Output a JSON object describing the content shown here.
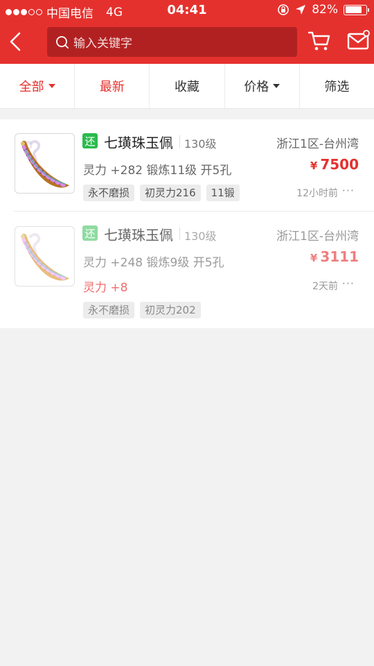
{
  "status_bar": {
    "carrier": "中国电信",
    "network": "4G",
    "time": "04:41",
    "battery": "82%",
    "battery_level": 0.82,
    "signal_bars": 3,
    "signal_total": 5
  },
  "nav": {
    "search_placeholder": "输入关键字"
  },
  "filters": {
    "all": "全部",
    "latest": "最新",
    "favorites": "收藏",
    "price": "价格",
    "screen": "筛选"
  },
  "listings": [
    {
      "badge": "还",
      "name": "七璜珠玉佩",
      "level": "130级",
      "server": "浙江1区-台州湾",
      "stats": "灵力 +282 锻炼11级 开5孔",
      "currency": "¥",
      "price": "7500",
      "tags": [
        "永不磨损",
        "初灵力216",
        "11锻"
      ],
      "time": "12小时前",
      "more": "···"
    },
    {
      "badge": "还",
      "name": "七璜珠玉佩",
      "level": "130级",
      "server": "浙江1区-台州湾",
      "stats": "灵力 +248 锻炼9级 开5孔",
      "bonus": "灵力 +8",
      "currency": "¥",
      "price": "3111",
      "tags": [
        "永不磨损",
        "初灵力202"
      ],
      "time": "2天前",
      "more": "···"
    }
  ],
  "colors": {
    "brand_red": "#e5312e",
    "search_bg": "#b22122",
    "badge_green": "#2bbb4d"
  }
}
